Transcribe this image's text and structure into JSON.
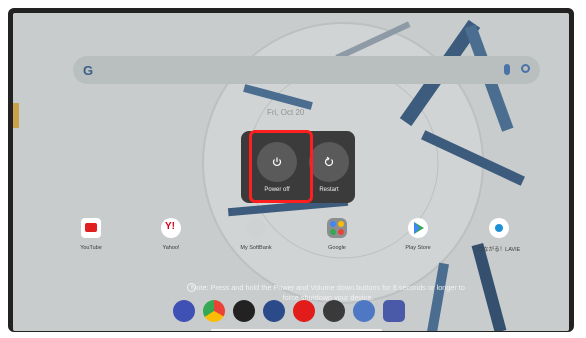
{
  "search": {
    "g_letter": "G"
  },
  "date": "Fri, Oct 20",
  "power_menu": {
    "power_off_label": "Power off",
    "restart_label": "Restart"
  },
  "apps": [
    {
      "label": "YouTube",
      "color": "#e02020"
    },
    {
      "label": "Yahoo!",
      "color": "#ffffff"
    },
    {
      "label": "My SoftBank",
      "color": "#cfd2d2"
    },
    {
      "label": "Google",
      "color": "#8c8f8f"
    },
    {
      "label": "Play Store",
      "color": "#ffffff"
    },
    {
      "label": "つながる！LAVIE",
      "color": "#ffffff"
    }
  ],
  "note": "Note: Press and hold the Power and Volume down buttons for 8 seconds or longer to force shutdown your device.",
  "colors": {
    "highlight": "#ff1f1f",
    "menu_bg": "#3b3b3b"
  }
}
